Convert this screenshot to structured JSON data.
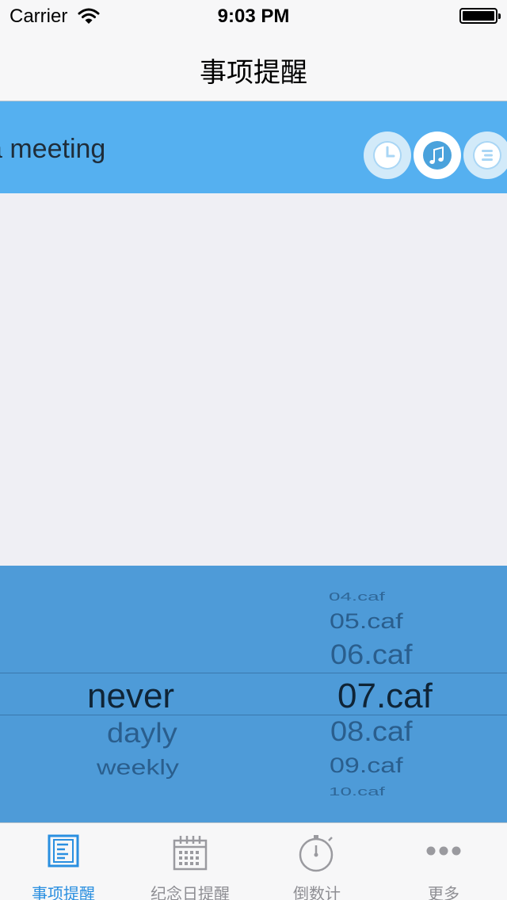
{
  "status_bar": {
    "carrier": "Carrier",
    "time": "9:03 PM"
  },
  "nav": {
    "title": "事项提醒"
  },
  "task": {
    "text": "a meeting",
    "buttons": [
      {
        "icon": "clock-icon"
      },
      {
        "icon": "music-note-icon",
        "selected": true
      },
      {
        "icon": "list-icon"
      }
    ]
  },
  "picker": {
    "repeat_column": {
      "selected": "never",
      "options": [
        "never",
        "dayly",
        "weekly"
      ]
    },
    "sound_column": {
      "selected": "07.caf",
      "options": [
        "04.caf",
        "05.caf",
        "06.caf",
        "07.caf",
        "08.caf",
        "09.caf",
        "10.caf"
      ]
    }
  },
  "tabbar": {
    "tabs": [
      {
        "label": "事项提醒",
        "icon": "reminder-list-icon",
        "active": true
      },
      {
        "label": "纪念日提醒",
        "icon": "calendar-icon",
        "active": false
      },
      {
        "label": "倒数计",
        "icon": "stopwatch-icon",
        "active": false
      },
      {
        "label": "更多",
        "icon": "more-dots-icon",
        "active": false
      }
    ]
  },
  "colors": {
    "accent": "#2a8fe0",
    "banner": "#55b0f0",
    "picker_bg": "#4e9bd8",
    "background": "#efeff4"
  }
}
